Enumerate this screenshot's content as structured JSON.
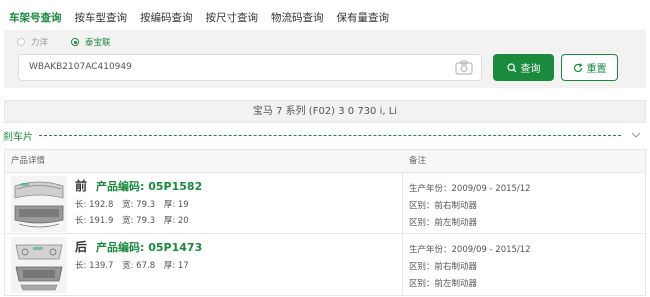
{
  "tabs": [
    {
      "label": "车架号查询",
      "active": true
    },
    {
      "label": "按车型查询",
      "active": false
    },
    {
      "label": "按编码查询",
      "active": false
    },
    {
      "label": "按尺寸查询",
      "active": false
    },
    {
      "label": "物流码查询",
      "active": false
    },
    {
      "label": "保有量查询",
      "active": false
    }
  ],
  "search": {
    "radios": [
      {
        "label": "力洋",
        "checked": false
      },
      {
        "label": "泰宝联",
        "checked": true
      }
    ],
    "vin_value": "WBAKB2107AC410949",
    "query_label": "查询",
    "reset_label": "重置"
  },
  "vehicle": {
    "name": "宝马 7 系列 (F02) 3 0 730 i, Li"
  },
  "section": {
    "title": "刹车片"
  },
  "table": {
    "headers": {
      "detail": "产品详情",
      "remark": "备注"
    },
    "rows": [
      {
        "position": "前",
        "code_label": "产品编码: 05P1582",
        "dims": [
          {
            "length": "长: 192.8",
            "width": "宽: 79.3",
            "thick": "厚: 19"
          },
          {
            "length": "长: 191.9",
            "width": "宽: 79.3",
            "thick": "厚: 20"
          }
        ],
        "remarks": [
          "生产年份：2009/09 - 2015/12",
          "区别：前右制动器",
          "区别：前左制动器"
        ]
      },
      {
        "position": "后",
        "code_label": "产品编码: 05P1473",
        "dims": [
          {
            "length": "长: 139.7",
            "width": "宽: 67.8",
            "thick": "厚: 17"
          }
        ],
        "remarks": [
          "生产年份：2009/09 - 2015/12",
          "区别：前右制动器",
          "区别：前左制动器"
        ]
      }
    ]
  },
  "colors": {
    "accent": "#1a8a3c",
    "panel": "#f2f2f2",
    "border": "#e6e6e6"
  },
  "icons": [
    "camera-icon",
    "search-icon",
    "refresh-icon",
    "chevron-down-icon",
    "brake-pad-icon"
  ]
}
